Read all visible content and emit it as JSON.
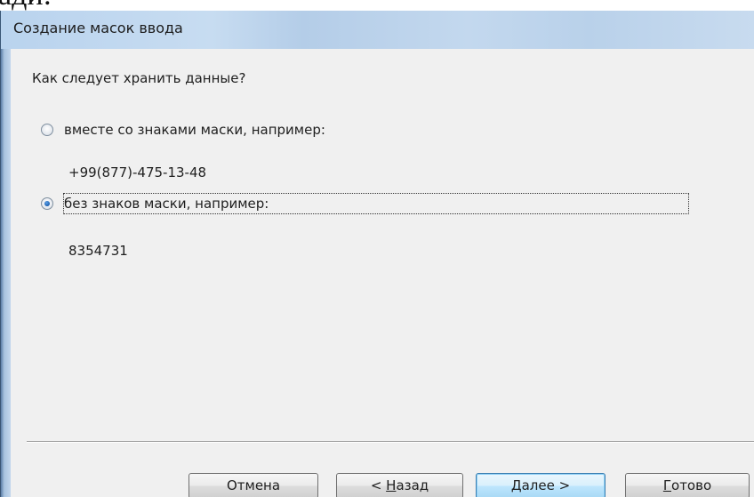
{
  "background_text": "ади:",
  "window": {
    "title": "Создание масок ввода"
  },
  "content": {
    "question": "Как следует хранить данные?",
    "options": [
      {
        "label": "вместе со знаками маски, например:",
        "example": "+99(877)-475-13-48",
        "selected": false
      },
      {
        "label": "без знаков маски, например:",
        "example": "8354731",
        "selected": true
      }
    ]
  },
  "buttons": {
    "cancel": "Отмена",
    "back_prefix": "< ",
    "back_mnemonic": "Н",
    "back_rest": "азад",
    "next_mnemonic": "Д",
    "next_rest": "алее >",
    "finish_mnemonic": "Г",
    "finish_rest": "отово"
  },
  "colors": {
    "title_bar": "#c3d8ee",
    "dialog_face": "#f0f0f0",
    "default_button_border": "#3c7fb1",
    "radio_dot": "#1c5fb0"
  }
}
